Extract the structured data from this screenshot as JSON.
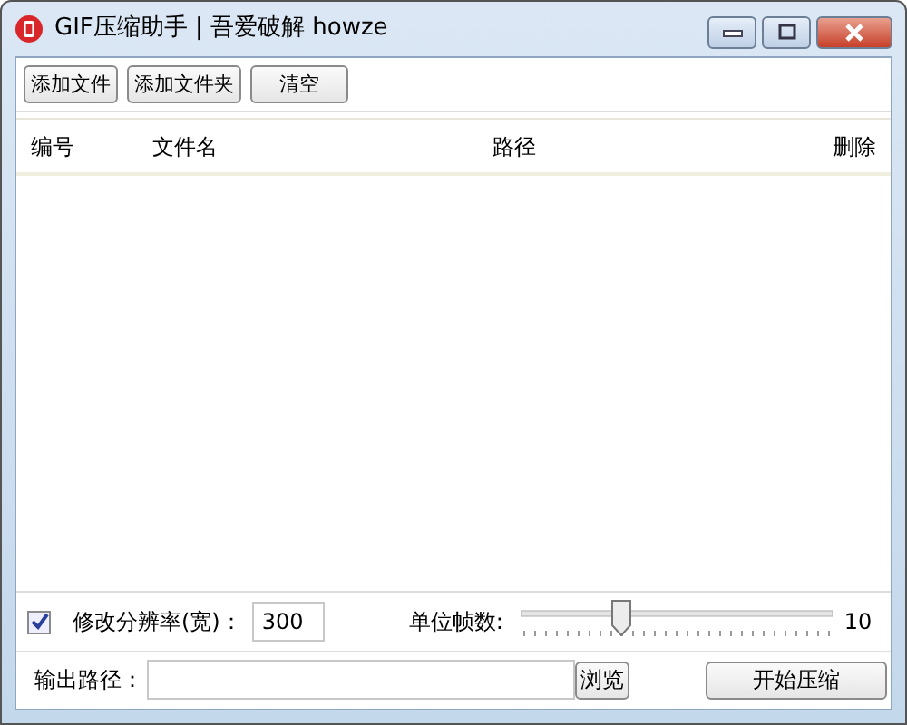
{
  "window": {
    "title": "GIF压缩助手 | 吾爱破解 howze"
  },
  "toolbar": {
    "buttons": [
      "添加文件",
      "添加文件夹",
      "清空"
    ]
  },
  "table": {
    "columns": [
      "编号",
      "文件名",
      "路径",
      "删除"
    ]
  },
  "resolution": {
    "checked": true,
    "label": "修改分辨率(宽)：",
    "value": "300"
  },
  "frame_unit": {
    "label": "单位帧数:",
    "level": 0.31,
    "reading": "10"
  },
  "output": {
    "label": "输出路径：",
    "browse_button": "浏览",
    "start_button": "开始压缩"
  }
}
